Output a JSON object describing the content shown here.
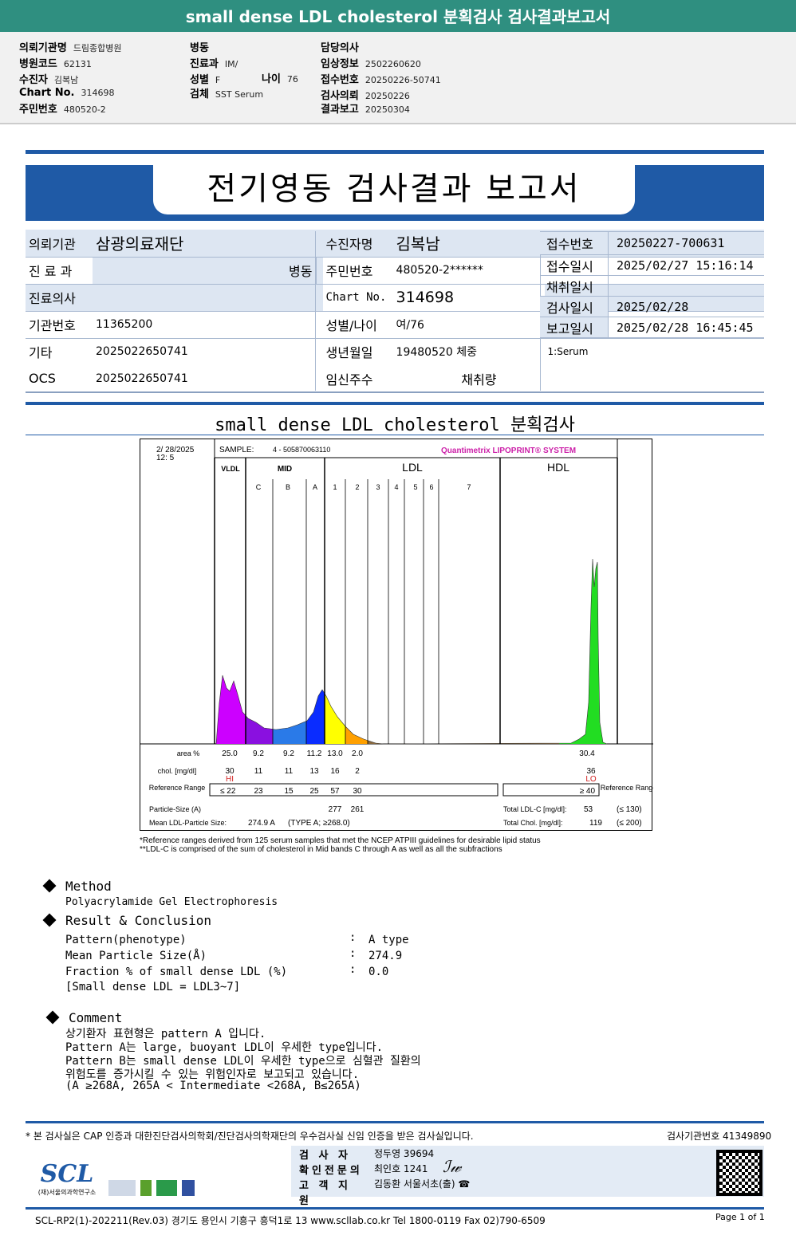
{
  "title": "small dense LDL cholesterol 분획검사 검사결과보고서",
  "info": {
    "col1": [
      {
        "k": "의뢰기관명",
        "v": "드림종합병원"
      },
      {
        "k": "병원코드",
        "v": "62131"
      },
      {
        "k": "수진자",
        "v": "김복남"
      },
      {
        "k": "Chart No.",
        "v": "314698"
      },
      {
        "k": "주민번호",
        "v": "480520-2"
      }
    ],
    "col2": [
      {
        "k": "병동",
        "v": ""
      },
      {
        "k": "진료과",
        "v": "IM/"
      },
      {
        "k": "성별",
        "v": "F"
      },
      {
        "k": "검체",
        "v": "SST Serum"
      }
    ],
    "age_label": "나이",
    "age": "76",
    "col3": [
      {
        "k": "담당의사",
        "v": ""
      },
      {
        "k": "임상정보",
        "v": "2502260620"
      },
      {
        "k": "접수번호",
        "v": "20250226-50741"
      },
      {
        "k": "검사의뢰",
        "v": "20250226"
      },
      {
        "k": "결과보고",
        "v": "20250304"
      }
    ]
  },
  "report_title": "전기영동 검사결과 보고서",
  "patient": {
    "l1": [
      "의뢰기관",
      "삼광의료재단",
      "수진자명",
      "김복남"
    ],
    "l2": [
      "진 료 과",
      "병동",
      "주민번호",
      "480520-2******"
    ],
    "l3": [
      "진료의사",
      "",
      "Chart No.",
      "314698"
    ],
    "l4": [
      "기관번호",
      "11365200",
      "성별/나이",
      "여/76"
    ],
    "l5": [
      "기타",
      "2025022650741",
      "생년월일",
      "19480520 체중"
    ],
    "l6": [
      "OCS",
      "2025022650741",
      "임신주수",
      "채취량"
    ],
    "right": [
      {
        "k": "접수번호",
        "v": "20250227-700631"
      },
      {
        "k": "접수일시",
        "v": "2025/02/27 15:16:14"
      },
      {
        "k": "채취일시",
        "v": ""
      },
      {
        "k": "검사일시",
        "v": "2025/02/28"
      },
      {
        "k": "보고일시",
        "v": "2025/02/28 16:45:45"
      }
    ],
    "specimen": "1:Serum"
  },
  "section_title": "small dense LDL cholesterol 분획검사",
  "chart": {
    "date": "2/ 28/2025",
    "time": "12:  5",
    "sample_label": "SAMPLE:",
    "sample": "4 - 505870063110",
    "system": "Quantimetrix LIPOPRINT® SYSTEM",
    "groups": [
      "VLDL",
      "MID",
      "LDL",
      "HDL"
    ],
    "bands": [
      "C",
      "B",
      "A",
      "1",
      "2",
      "3",
      "4",
      "5",
      "6",
      "7"
    ],
    "row_labels": {
      "area": "area %",
      "chol": "chol. [mg/dl]",
      "ref": "Reference Range",
      "ref_right": "Reference Range",
      "psize": "Particle-Size (A)",
      "mean": "Mean LDL-Particle Size:"
    },
    "area": [
      "25.0",
      "9.2",
      "9.2",
      "11.2",
      "13.0",
      "2.0"
    ],
    "area_hdl": "30.4",
    "chol": [
      "30",
      "11",
      "11",
      "13",
      "16",
      "2"
    ],
    "chol_hdl": "36",
    "flag_vldl": "HI",
    "flag_hdl": "LO",
    "ref": [
      "≤ 22",
      "23",
      "15",
      "25",
      "57",
      "30"
    ],
    "ref_hdl": "≥  40",
    "psize": [
      "277",
      "261"
    ],
    "mean_value": "274.9  A",
    "mean_type": "(TYPE A; ≥268.0)",
    "total_ldl_label": "Total LDL-C  [mg/dl]:",
    "total_ldl": "53",
    "total_ldl_ref": "(≤ 130)",
    "total_chol_label": "Total Chol.  [mg/dl]:",
    "total_chol": "119",
    "total_chol_ref": "(≤ 200)",
    "colors": {
      "vldl": "#cc00ff",
      "c": "#8a10e0",
      "b": "#2a7ae8",
      "a": "#0a2cff",
      "ldl1": "#ffff00",
      "ldl2": "#ffa000",
      "hdl": "#22dd22"
    }
  },
  "footnotes": [
    "*Reference ranges derived from 125 serum samples that met the NCEP ATPIII guidelines for desirable lipid status",
    "**LDL-C is comprised of the sum of cholesterol in Mid bands C through A as well as all the subfractions"
  ],
  "method": {
    "title": "Method",
    "text": "Polyacrylamide Gel Electrophoresis"
  },
  "result": {
    "title": "Result & Conclusion",
    "rows": [
      {
        "k": "Pattern(phenotype)",
        "v": "A type"
      },
      {
        "k": "Mean Particle Size(Å)",
        "v": "274.9"
      },
      {
        "k": "Fraction % of small dense LDL (%)",
        "v": "0.0"
      }
    ],
    "note": "[Small dense LDL = LDL3~7]"
  },
  "comment": {
    "title": "Comment",
    "lines": [
      "상기환자 표현형은 pattern A 입니다.",
      "Pattern A는 large, buoyant LDL이 우세한 type입니다.",
      "Pattern B는 small dense LDL이 우세한 type으로 심혈관 질환의",
      "위험도를 증가시킬 수 있는 위험인자로 보고되고 있습니다.",
      "(A ≥268A, 265A < Intermediate <268A, B≤265A)"
    ]
  },
  "footer": {
    "cert": "* 본 검사실은 CAP 인증과 대한진단검사의학회/진단검사의학재단의 우수검사실 신임 인증을 받은 검사실입니다.",
    "lab_no": "검사기관번호  41349890",
    "signers": [
      {
        "k": "검  사  자",
        "v": "정두영 39694"
      },
      {
        "k": "확인전문의",
        "v": "최인호 1241"
      },
      {
        "k": "고 객 지 원",
        "v": "김동환 서울서초(출) ☎"
      }
    ],
    "logo": "SCL",
    "logo_sub": "(재)서울의과학연구소",
    "address": "SCL-RP2(1)-202211(Rev.03)  경기도 용인시 기흥구 흥덕1로 13   www.scllab.co.kr   Tel 1800-0119    Fax 02)790-6509",
    "page": "Page 1 of 1"
  }
}
